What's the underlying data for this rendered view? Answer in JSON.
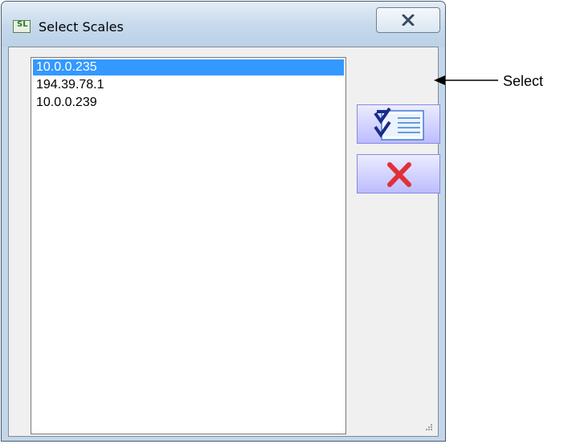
{
  "window": {
    "title": "Select Scales",
    "icon": "app-icon",
    "app_icon_text": "SL"
  },
  "list": {
    "items": [
      "10.0.0.235",
      "194.39.78.1",
      "10.0.0.239"
    ],
    "selected_item": "10.0.0.235"
  },
  "buttons": {
    "select_icon": "checklist-icon",
    "cancel_icon": "x-icon",
    "close_icon": "close-icon"
  },
  "annotation": {
    "label": "Select"
  },
  "colors": {
    "selection": "#3399ff",
    "cancel_x": "#e0303a",
    "button_face": "#c8c8ff"
  }
}
